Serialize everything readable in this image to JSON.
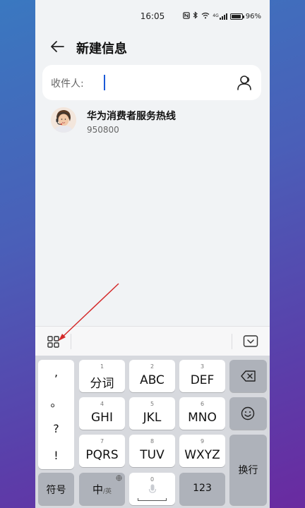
{
  "status_bar": {
    "time": "16:05",
    "signal_label": "4G",
    "battery": "96%",
    "battery_level": 0.96
  },
  "header": {
    "title": "新建信息"
  },
  "recipient": {
    "label": "收件人:",
    "value": ""
  },
  "suggestion": {
    "name": "华为消费者服务热线",
    "number": "950800"
  },
  "keyboard": {
    "punctuation": [
      ",",
      "。",
      "?",
      "!"
    ],
    "rows": [
      [
        {
          "num": "1",
          "label": "分词"
        },
        {
          "num": "2",
          "label": "ABC"
        },
        {
          "num": "3",
          "label": "DEF"
        }
      ],
      [
        {
          "num": "4",
          "label": "GHI"
        },
        {
          "num": "5",
          "label": "JKL"
        },
        {
          "num": "6",
          "label": "MNO"
        }
      ],
      [
        {
          "num": "7",
          "label": "PQRS"
        },
        {
          "num": "8",
          "label": "TUV"
        },
        {
          "num": "9",
          "label": "WXYZ"
        }
      ]
    ],
    "enter_label": "换行",
    "symbols_label": "符号",
    "lang_main": "中",
    "lang_sub": "/英",
    "space_num": "0",
    "numbers_label": "123"
  }
}
